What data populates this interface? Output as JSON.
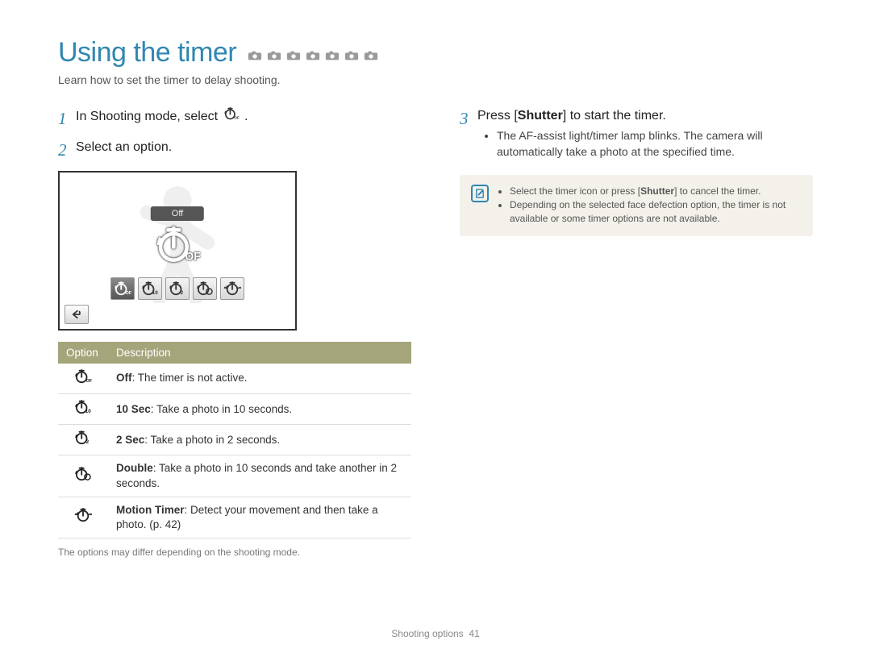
{
  "title": "Using the timer",
  "subtitle": "Learn how to set the timer to delay shooting.",
  "mode_icons": [
    "camera-smart",
    "camera",
    "camera-plus",
    "scene",
    "dual",
    "hand",
    "movie",
    "movie-smart"
  ],
  "steps": {
    "1": {
      "num": "1",
      "text_prefix": "In Shooting mode, select ",
      "text_suffix": "."
    },
    "2": {
      "num": "2",
      "text": "Select an option."
    },
    "3": {
      "num": "3",
      "text_prefix": "Press [",
      "bold": "Shutter",
      "text_suffix": "] to start the timer.",
      "bullets": [
        "The AF-assist light/timer lamp blinks. The camera will automatically take a photo at the specified time."
      ]
    }
  },
  "screen": {
    "off_label": "Off",
    "options": [
      "timer-off",
      "timer-10",
      "timer-2",
      "timer-double",
      "timer-motion"
    ],
    "selected_index": 0
  },
  "table": {
    "headers": [
      "Option",
      "Description"
    ],
    "rows": [
      {
        "icon": "timer-off",
        "bold": "Off",
        "rest": ": The timer is not active."
      },
      {
        "icon": "timer-10",
        "bold": "10 Sec",
        "rest": ": Take a photo in 10 seconds."
      },
      {
        "icon": "timer-2",
        "bold": "2 Sec",
        "rest": ": Take a photo in 2 seconds."
      },
      {
        "icon": "timer-double",
        "bold": "Double",
        "rest": ": Take a photo in 10 seconds and take another in 2 seconds."
      },
      {
        "icon": "timer-motion",
        "bold": "Motion Timer",
        "rest": ": Detect your movement and then take a photo. (p. 42)"
      }
    ]
  },
  "options_note": "The options may differ depending on the shooting mode.",
  "info": {
    "items": [
      {
        "prefix": "Select the timer icon or press [",
        "bold": "Shutter",
        "suffix": "] to cancel the timer."
      },
      {
        "text": "Depending on the selected face defection option, the timer is not available or some timer options are not available."
      }
    ]
  },
  "footer": {
    "section": "Shooting options",
    "page": "41"
  }
}
